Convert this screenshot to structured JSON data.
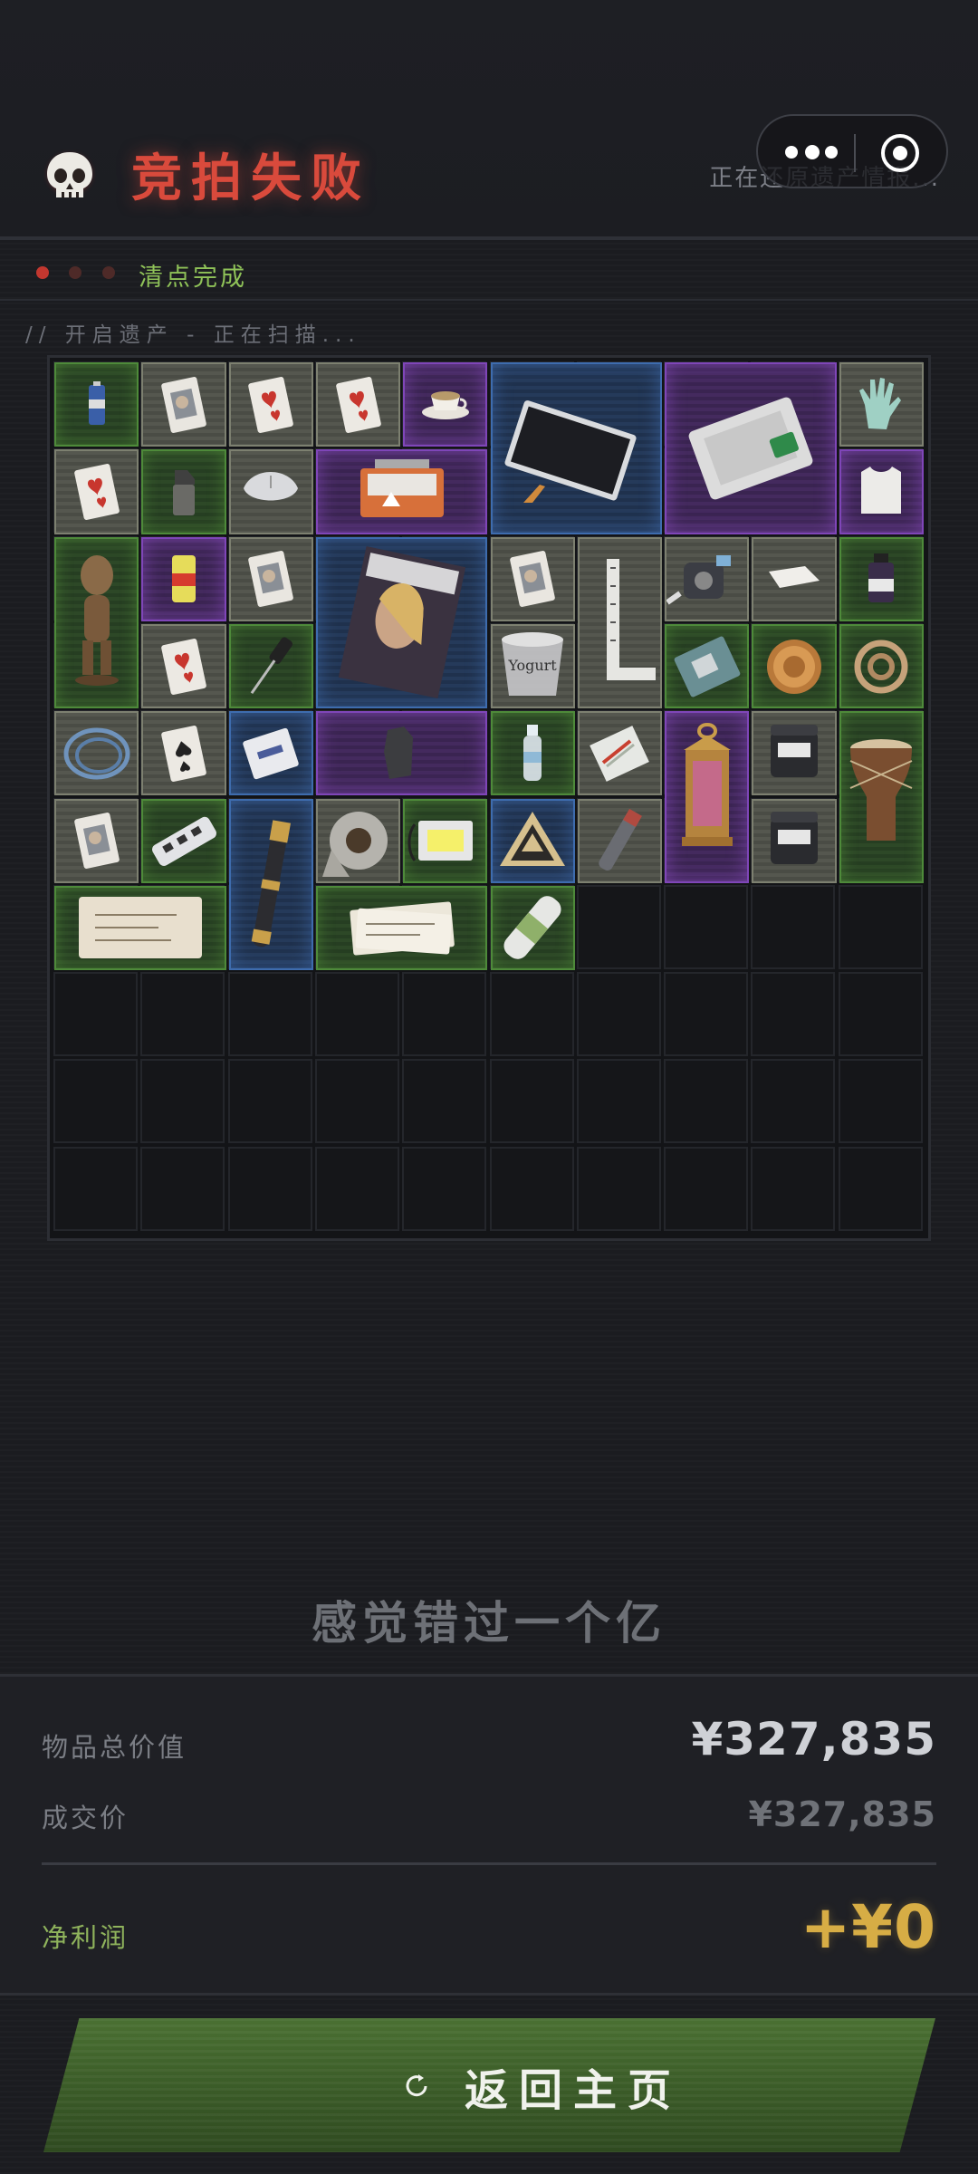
{
  "header": {
    "title": "竞拍失败",
    "restoring_text": "正在还原遗产情报...",
    "skull_icon": "skull-icon",
    "menu_icon": "more-dots-icon",
    "target_icon": "close-target-icon"
  },
  "status": {
    "dots": [
      "#c2372f",
      "#5a2a28",
      "#5a2a28"
    ],
    "text": "清点完成"
  },
  "scan_text": "// 开启遗产 - 正在扫描...",
  "inventory": {
    "columns": 10,
    "rows": 10,
    "items": [
      {
        "name": "battery",
        "icon": "battery-icon",
        "rarity": "green"
      },
      {
        "name": "playing-card",
        "icon": "face-card-icon",
        "rarity": "white"
      },
      {
        "name": "playing-card",
        "icon": "heart-card-icon",
        "rarity": "white"
      },
      {
        "name": "playing-card",
        "icon": "heart-card-icon",
        "rarity": "white"
      },
      {
        "name": "teacup",
        "icon": "teacup-icon",
        "rarity": "purple"
      },
      {
        "name": "tablet",
        "icon": "tablet-icon",
        "rarity": "blue"
      },
      {
        "name": "hard-drive",
        "icon": "ssd-icon",
        "rarity": "purple"
      },
      {
        "name": "glove",
        "icon": "glove-icon",
        "rarity": "white"
      },
      {
        "name": "playing-card",
        "icon": "heart-card-icon",
        "rarity": "white"
      },
      {
        "name": "lighter",
        "icon": "lighter-icon",
        "rarity": "green"
      },
      {
        "name": "mouse",
        "icon": "mouse-icon",
        "rarity": "white"
      },
      {
        "name": "chip-pack",
        "icon": "chip-pack-icon",
        "rarity": "purple"
      },
      {
        "name": "vest",
        "icon": "vest-icon",
        "rarity": "purple"
      },
      {
        "name": "statue",
        "icon": "statue-icon",
        "rarity": "green"
      },
      {
        "name": "energy-drink",
        "icon": "can-icon",
        "rarity": "purple"
      },
      {
        "name": "playing-card",
        "icon": "face-card-icon",
        "rarity": "white"
      },
      {
        "name": "magazine",
        "icon": "magazine-icon",
        "rarity": "blue"
      },
      {
        "name": "playing-card",
        "icon": "face-card-icon",
        "rarity": "white"
      },
      {
        "name": "ruler",
        "icon": "ruler-icon",
        "rarity": "white"
      },
      {
        "name": "tape-measure",
        "icon": "tape-measure-icon",
        "rarity": "white"
      },
      {
        "name": "napkin",
        "icon": "napkin-icon",
        "rarity": "white"
      },
      {
        "name": "medicine",
        "icon": "vial-icon",
        "rarity": "green"
      },
      {
        "name": "playing-card",
        "icon": "heart-card-icon",
        "rarity": "white"
      },
      {
        "name": "screwdriver",
        "icon": "screwdriver-icon",
        "rarity": "green"
      },
      {
        "name": "yogurt",
        "icon": "yogurt-icon",
        "rarity": "white"
      },
      {
        "name": "circuit",
        "icon": "circuit-icon",
        "rarity": "green"
      },
      {
        "name": "coin",
        "icon": "coin-icon",
        "rarity": "green"
      },
      {
        "name": "hose",
        "icon": "hose-icon",
        "rarity": "green"
      },
      {
        "name": "cable",
        "icon": "cable-icon",
        "rarity": "white"
      },
      {
        "name": "playing-card",
        "icon": "spade-card-icon",
        "rarity": "white"
      },
      {
        "name": "sachet",
        "icon": "sachet-icon",
        "rarity": "blue"
      },
      {
        "name": "ore",
        "icon": "ore-icon",
        "rarity": "purple"
      },
      {
        "name": "water-bottle",
        "icon": "bottle-icon",
        "rarity": "green"
      },
      {
        "name": "matchbox",
        "icon": "matchbox-icon",
        "rarity": "white"
      },
      {
        "name": "lantern",
        "icon": "lantern-icon",
        "rarity": "purple"
      },
      {
        "name": "protein-jar",
        "icon": "jar-icon",
        "rarity": "white"
      },
      {
        "name": "drum",
        "icon": "drum-icon",
        "rarity": "green"
      },
      {
        "name": "playing-card",
        "icon": "face-card-icon",
        "rarity": "white"
      },
      {
        "name": "power-strip",
        "icon": "power-strip-icon",
        "rarity": "green"
      },
      {
        "name": "telescope",
        "icon": "telescope-icon",
        "rarity": "blue"
      },
      {
        "name": "tape-roll",
        "icon": "tape-roll-icon",
        "rarity": "white"
      },
      {
        "name": "led-panel",
        "icon": "panel-icon",
        "rarity": "green"
      },
      {
        "name": "triangle-badge",
        "icon": "triangle-icon",
        "rarity": "blue"
      },
      {
        "name": "spray",
        "icon": "spray-icon",
        "rarity": "white"
      },
      {
        "name": "protein-jar",
        "icon": "jar-icon",
        "rarity": "white"
      },
      {
        "name": "old-map",
        "icon": "scroll-icon",
        "rarity": "green"
      },
      {
        "name": "documents",
        "icon": "papers-icon",
        "rarity": "green"
      },
      {
        "name": "grip",
        "icon": "grip-icon",
        "rarity": "green"
      }
    ]
  },
  "quip": "感觉错过一个亿",
  "summary": {
    "total_label": "物品总价值",
    "total_value": "¥327,835",
    "deal_label": "成交价",
    "deal_value": "¥327,835",
    "profit_label": "净利润",
    "profit_value": "+¥0",
    "colors": {
      "total": "#cfd1d6",
      "deal": "#6f7278",
      "profit": "#d7ad45",
      "profit_label": "#8fb35c"
    }
  },
  "return_button": {
    "label": "返回主页",
    "icon": "refresh-icon"
  }
}
